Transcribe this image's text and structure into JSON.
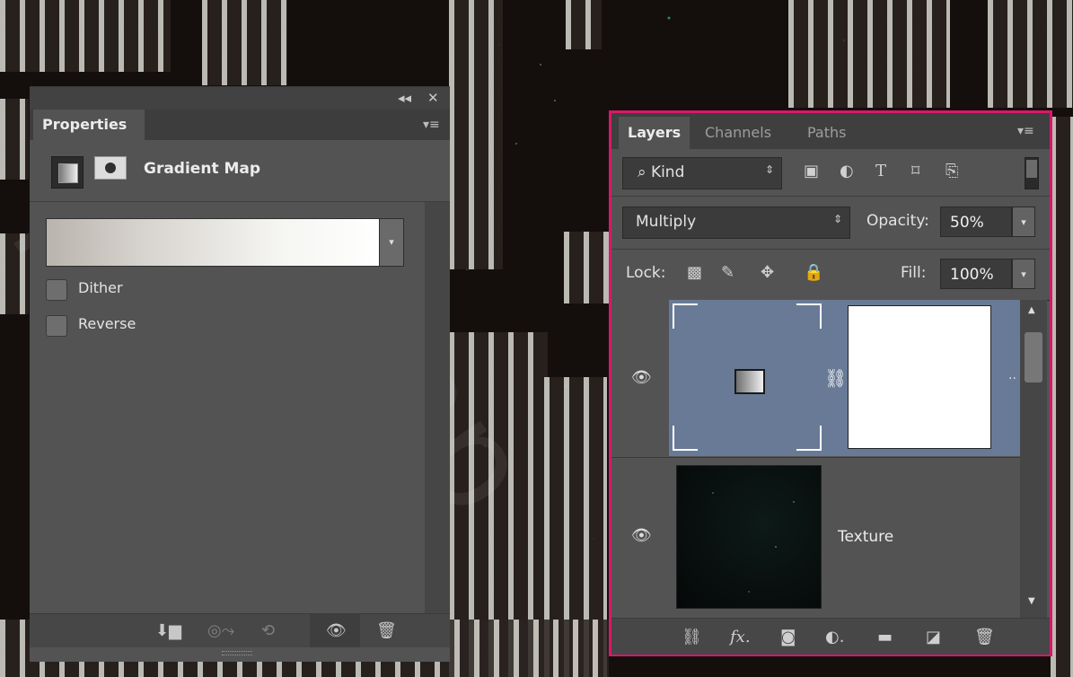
{
  "properties_panel": {
    "collapse_label": "◂◂",
    "close_label": "✕",
    "tab_label": "Properties",
    "menu_label": "▾≡",
    "adjustment_title": "Gradient Map",
    "dropdown_arrow": "▾",
    "dither_label": "Dither",
    "reverse_label": "Reverse",
    "footer_icons": [
      "clip-to-layer-icon",
      "view-previous-state-icon",
      "reset-icon",
      "visibility-icon",
      "delete-icon"
    ]
  },
  "layers_panel": {
    "tabs": [
      {
        "label": "Layers",
        "active": true
      },
      {
        "label": "Channels",
        "active": false
      },
      {
        "label": "Paths",
        "active": false
      }
    ],
    "menu_label": "▾≡",
    "filter": {
      "label": "Kind",
      "arrow": "⇕"
    },
    "filter_icons": [
      "pixel-filter-icon",
      "adjustment-filter-icon",
      "type-filter-icon",
      "shape-filter-icon",
      "smart-object-filter-icon"
    ],
    "blend_mode": "Multiply",
    "opacity_label": "Opacity:",
    "opacity_value": "50%",
    "lock_label": "Lock:",
    "fill_label": "Fill:",
    "fill_value": "100%",
    "layers": [
      {
        "name": "",
        "type": "gradient-map-adjustment",
        "selected": true,
        "visible": true
      },
      {
        "name": "Texture",
        "type": "image",
        "selected": false,
        "visible": true
      }
    ],
    "footer_icons": [
      "link-layers-icon",
      "fx-icon",
      "add-mask-icon",
      "new-adjustment-icon",
      "new-group-icon",
      "new-layer-icon",
      "delete-icon"
    ]
  },
  "colors": {
    "panel_bg": "#535353",
    "highlight": "#d8186a",
    "selected_layer": "#687a96"
  }
}
